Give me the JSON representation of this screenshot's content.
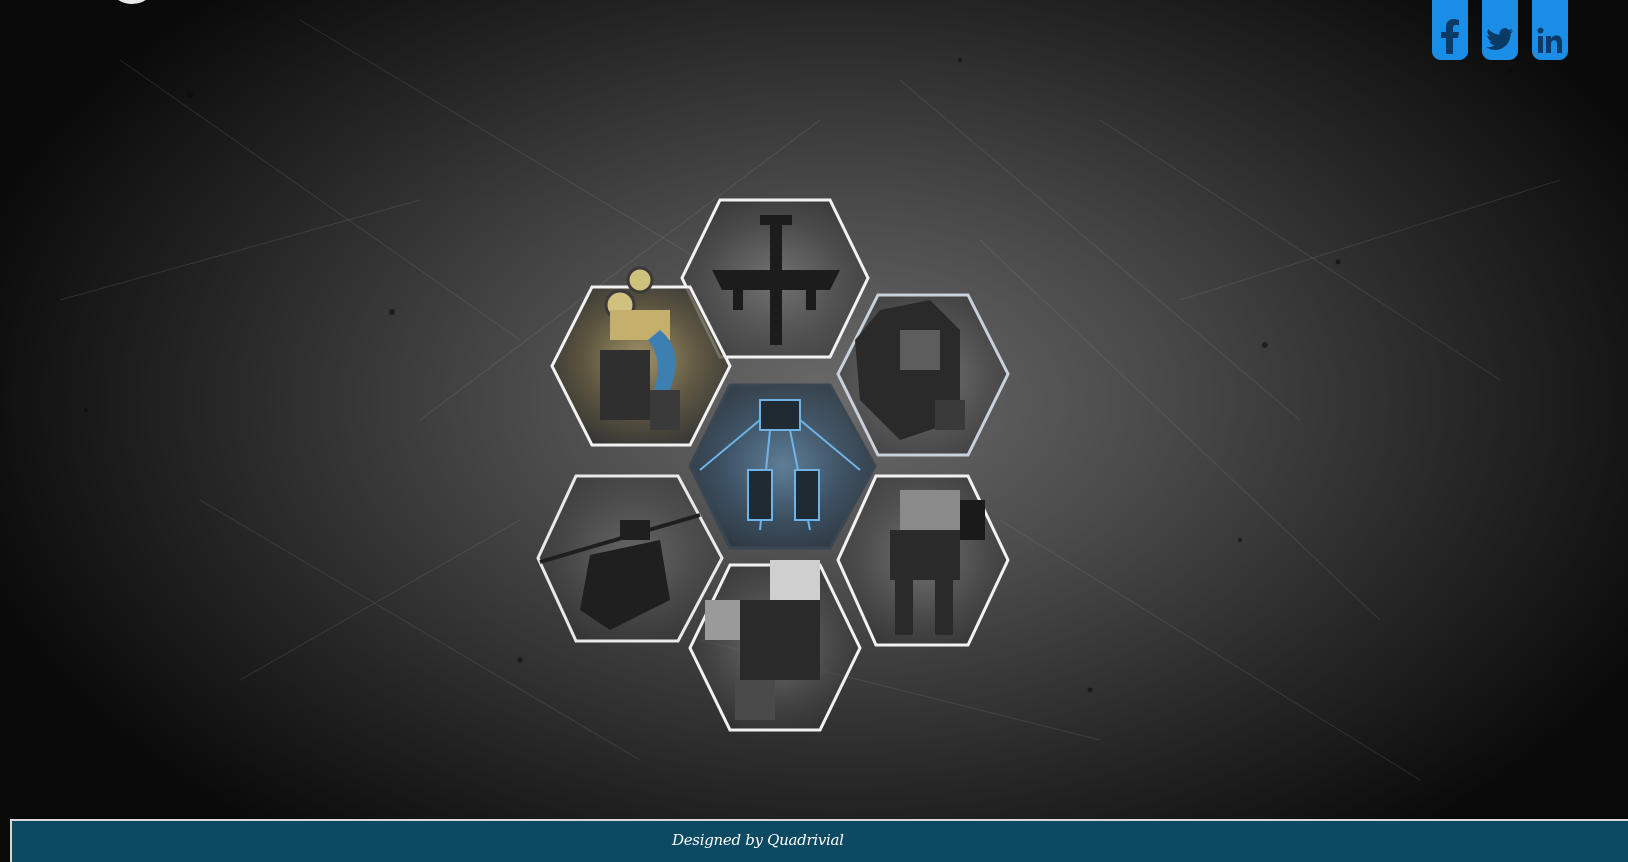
{
  "header": {
    "logo_icon": "logo-circle-icon",
    "social": [
      {
        "name": "facebook",
        "icon": "facebook-icon",
        "color": "#1a8ee6"
      },
      {
        "name": "twitter",
        "icon": "twitter-icon",
        "color": "#1a8ee6"
      },
      {
        "name": "linkedin",
        "icon": "linkedin-icon",
        "color": "#1a8ee6"
      }
    ]
  },
  "gallery": {
    "tiles": [
      {
        "id": "tank-top",
        "icon": "gunship-robot-image",
        "tint": "#5a5a5a"
      },
      {
        "id": "mech-gold",
        "icon": "gold-mech-robot-image",
        "tint": "#8a7a45"
      },
      {
        "id": "tank-right",
        "icon": "heavy-tank-robot-image",
        "tint": "#6a6a6a"
      },
      {
        "id": "spider-center",
        "icon": "spider-walker-robot-image",
        "tint": "#4f7fa3"
      },
      {
        "id": "helicopter",
        "icon": "helicopter-robot-image",
        "tint": "#4a4a4a"
      },
      {
        "id": "walker-right",
        "icon": "walker-mech-robot-image",
        "tint": "#5e5e5e"
      },
      {
        "id": "crawler-bottom",
        "icon": "crawler-robot-image",
        "tint": "#6b6b6b"
      }
    ],
    "hex_border_color": "#f2f2f2"
  },
  "footer": {
    "credit": "Designed by Quadrivial",
    "background": "#0c4a64"
  }
}
